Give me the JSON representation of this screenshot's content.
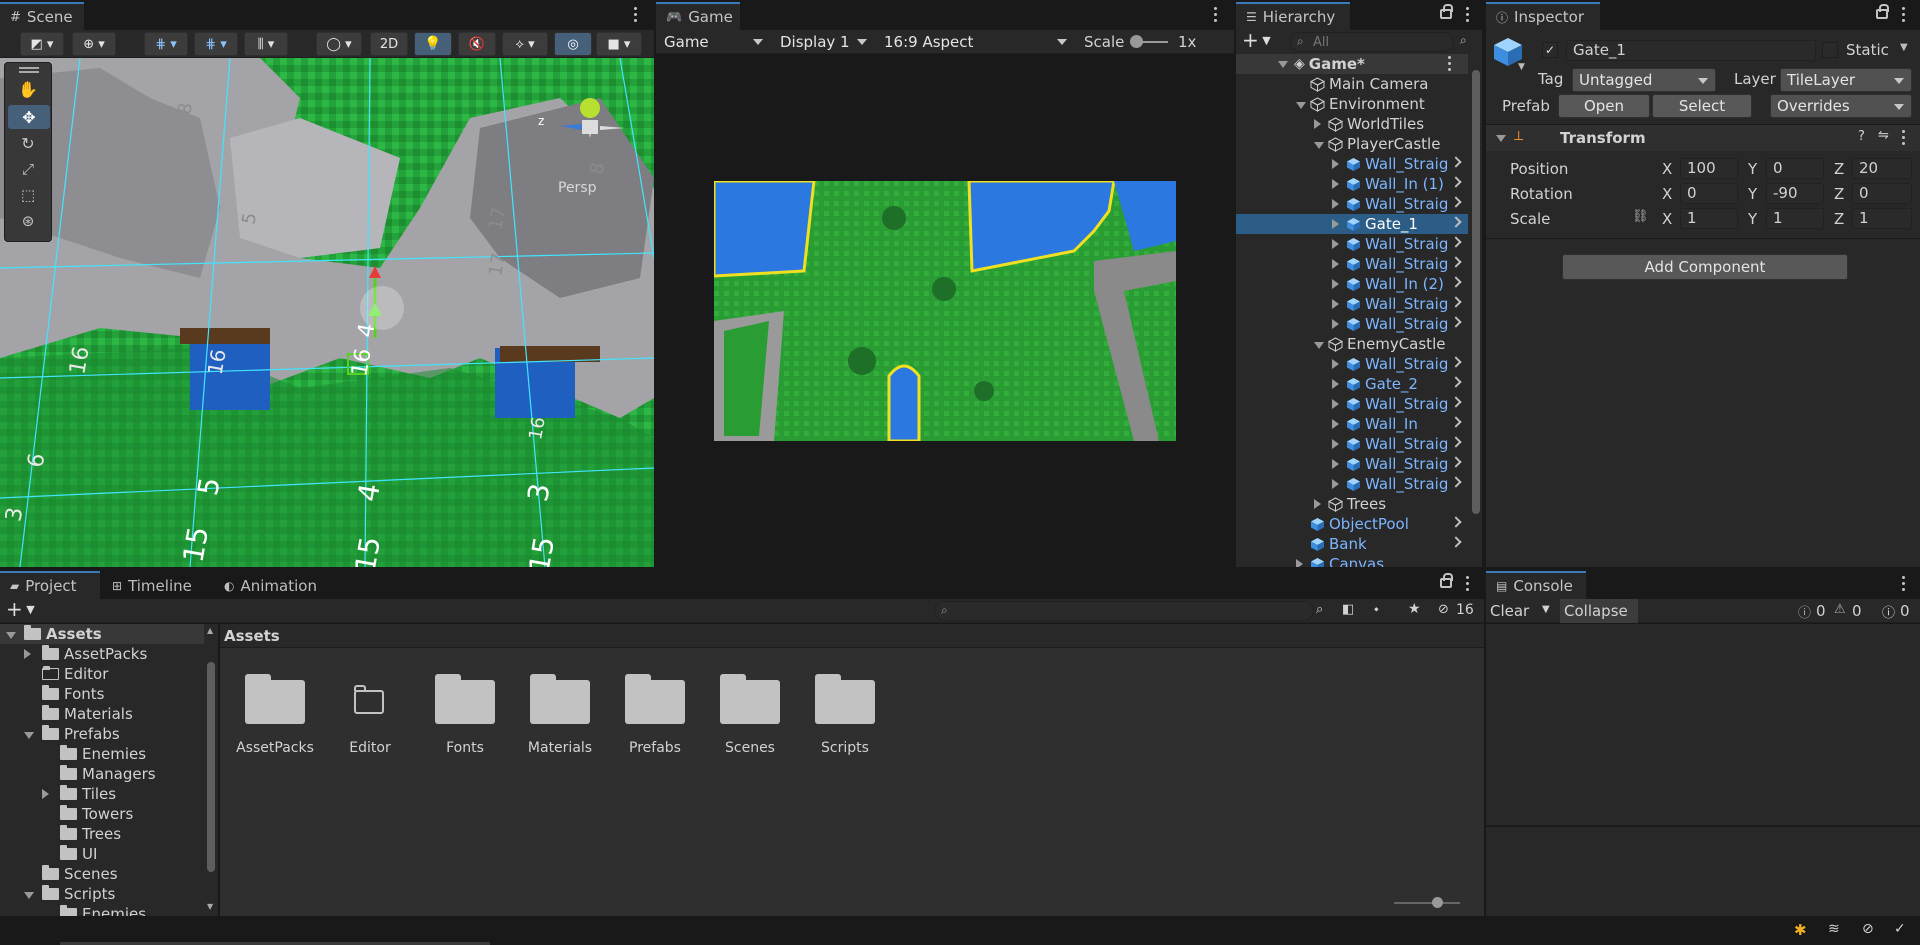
{
  "scene": {
    "tab_label": "Scene",
    "btn_2d": "2D",
    "persp_label": "Persp",
    "axis_z": "z",
    "grid_labels": [
      "16",
      "16",
      "4",
      "15",
      "5",
      "15",
      "4",
      "15",
      "3",
      "16",
      "6",
      "5",
      "17",
      "17",
      "8",
      "8",
      "3",
      "16"
    ]
  },
  "game": {
    "tab_label": "Game",
    "display_select": "Game",
    "display_num": "Display 1",
    "aspect": "16:9 Aspect",
    "scale_label": "Scale",
    "scale_value": "1x"
  },
  "hierarchy": {
    "tab_label": "Hierarchy",
    "search_placeholder": "All",
    "root": "Game*",
    "rows": [
      {
        "label": "Main Camera",
        "indent": 1,
        "arrow": "none",
        "prefab": false,
        "chev": false
      },
      {
        "label": "Environment",
        "indent": 1,
        "arrow": "down",
        "prefab": false,
        "chev": false
      },
      {
        "label": "WorldTiles",
        "indent": 2,
        "arrow": "right",
        "prefab": false,
        "chev": false
      },
      {
        "label": "PlayerCastle",
        "indent": 2,
        "arrow": "down",
        "prefab": false,
        "chev": false
      },
      {
        "label": "Wall_Straig",
        "indent": 3,
        "arrow": "right",
        "prefab": true,
        "chev": true
      },
      {
        "label": "Wall_In (1)",
        "indent": 3,
        "arrow": "right",
        "prefab": true,
        "chev": true
      },
      {
        "label": "Wall_Straig",
        "indent": 3,
        "arrow": "right",
        "prefab": true,
        "chev": true
      },
      {
        "label": "Gate_1",
        "indent": 3,
        "arrow": "right",
        "prefab": true,
        "chev": true,
        "selected": true
      },
      {
        "label": "Wall_Straig",
        "indent": 3,
        "arrow": "right",
        "prefab": true,
        "chev": true
      },
      {
        "label": "Wall_Straig",
        "indent": 3,
        "arrow": "right",
        "prefab": true,
        "chev": true
      },
      {
        "label": "Wall_In (2)",
        "indent": 3,
        "arrow": "right",
        "prefab": true,
        "chev": true
      },
      {
        "label": "Wall_Straig",
        "indent": 3,
        "arrow": "right",
        "prefab": true,
        "chev": true
      },
      {
        "label": "Wall_Straig",
        "indent": 3,
        "arrow": "right",
        "prefab": true,
        "chev": true
      },
      {
        "label": "EnemyCastle",
        "indent": 2,
        "arrow": "down",
        "prefab": false,
        "chev": false
      },
      {
        "label": "Wall_Straig",
        "indent": 3,
        "arrow": "right",
        "prefab": true,
        "chev": true
      },
      {
        "label": "Gate_2",
        "indent": 3,
        "arrow": "right",
        "prefab": true,
        "chev": true
      },
      {
        "label": "Wall_Straig",
        "indent": 3,
        "arrow": "right",
        "prefab": true,
        "chev": true
      },
      {
        "label": "Wall_In",
        "indent": 3,
        "arrow": "right",
        "prefab": true,
        "chev": true
      },
      {
        "label": "Wall_Straig",
        "indent": 3,
        "arrow": "right",
        "prefab": true,
        "chev": true
      },
      {
        "label": "Wall_Straig",
        "indent": 3,
        "arrow": "right",
        "prefab": true,
        "chev": true
      },
      {
        "label": "Wall_Straig",
        "indent": 3,
        "arrow": "right",
        "prefab": true,
        "chev": true
      },
      {
        "label": "Trees",
        "indent": 2,
        "arrow": "right",
        "prefab": false,
        "chev": false
      },
      {
        "label": "ObjectPool",
        "indent": 1,
        "arrow": "none",
        "prefab": true,
        "chev": true
      },
      {
        "label": "Bank",
        "indent": 1,
        "arrow": "none",
        "prefab": true,
        "chev": true
      },
      {
        "label": "Canvas",
        "indent": 1,
        "arrow": "right",
        "prefab": true,
        "chev": false
      }
    ]
  },
  "inspector": {
    "tab_label": "Inspector",
    "object_name": "Gate_1",
    "static_label": "Static",
    "tag_label": "Tag",
    "tag_value": "Untagged",
    "layer_label": "Layer",
    "layer_value": "TileLayer",
    "prefab_label": "Prefab",
    "open_btn": "Open",
    "select_btn": "Select",
    "overrides_btn": "Overrides",
    "component_title": "Transform",
    "position_label": "Position",
    "rotation_label": "Rotation",
    "scale_label": "Scale",
    "x_label": "X",
    "y_label": "Y",
    "z_label": "Z",
    "position": {
      "x": "100",
      "y": "0",
      "z": "20"
    },
    "rotation": {
      "x": "0",
      "y": "-90",
      "z": "0"
    },
    "scale": {
      "x": "1",
      "y": "1",
      "z": "1"
    },
    "add_component": "Add Component"
  },
  "project": {
    "tab_project": "Project",
    "tab_timeline": "Timeline",
    "tab_animation": "Animation",
    "hidden_count": "16",
    "breadcrumb": "Assets",
    "tree": [
      {
        "label": "Assets",
        "indent": 0,
        "arrow": "down",
        "bold": true,
        "open": true
      },
      {
        "label": "AssetPacks",
        "indent": 1,
        "arrow": "right"
      },
      {
        "label": "Editor",
        "indent": 1,
        "arrow": "none",
        "empty": true
      },
      {
        "label": "Fonts",
        "indent": 1,
        "arrow": "none"
      },
      {
        "label": "Materials",
        "indent": 1,
        "arrow": "none"
      },
      {
        "label": "Prefabs",
        "indent": 1,
        "arrow": "down",
        "open": true
      },
      {
        "label": "Enemies",
        "indent": 2,
        "arrow": "none"
      },
      {
        "label": "Managers",
        "indent": 2,
        "arrow": "none"
      },
      {
        "label": "Tiles",
        "indent": 2,
        "arrow": "right"
      },
      {
        "label": "Towers",
        "indent": 2,
        "arrow": "none"
      },
      {
        "label": "Trees",
        "indent": 2,
        "arrow": "none"
      },
      {
        "label": "UI",
        "indent": 2,
        "arrow": "none"
      },
      {
        "label": "Scenes",
        "indent": 1,
        "arrow": "none"
      },
      {
        "label": "Scripts",
        "indent": 1,
        "arrow": "down",
        "open": true
      },
      {
        "label": "Enemies",
        "indent": 2,
        "arrow": "none"
      }
    ],
    "folders": [
      {
        "label": "AssetPacks",
        "empty": false
      },
      {
        "label": "Editor",
        "empty": true
      },
      {
        "label": "Fonts",
        "empty": false
      },
      {
        "label": "Materials",
        "empty": false
      },
      {
        "label": "Prefabs",
        "empty": false
      },
      {
        "label": "Scenes",
        "empty": false
      },
      {
        "label": "Scripts",
        "empty": false
      }
    ]
  },
  "console": {
    "tab_label": "Console",
    "clear_btn": "Clear",
    "collapse_btn": "Collapse",
    "info_count": "0",
    "warn_count": "0",
    "error_count": "0"
  },
  "colors": {
    "accent": "#2c5d87",
    "prefab_text": "#7cb5ff",
    "panel_bg": "#282828",
    "window_bg": "#191919"
  }
}
